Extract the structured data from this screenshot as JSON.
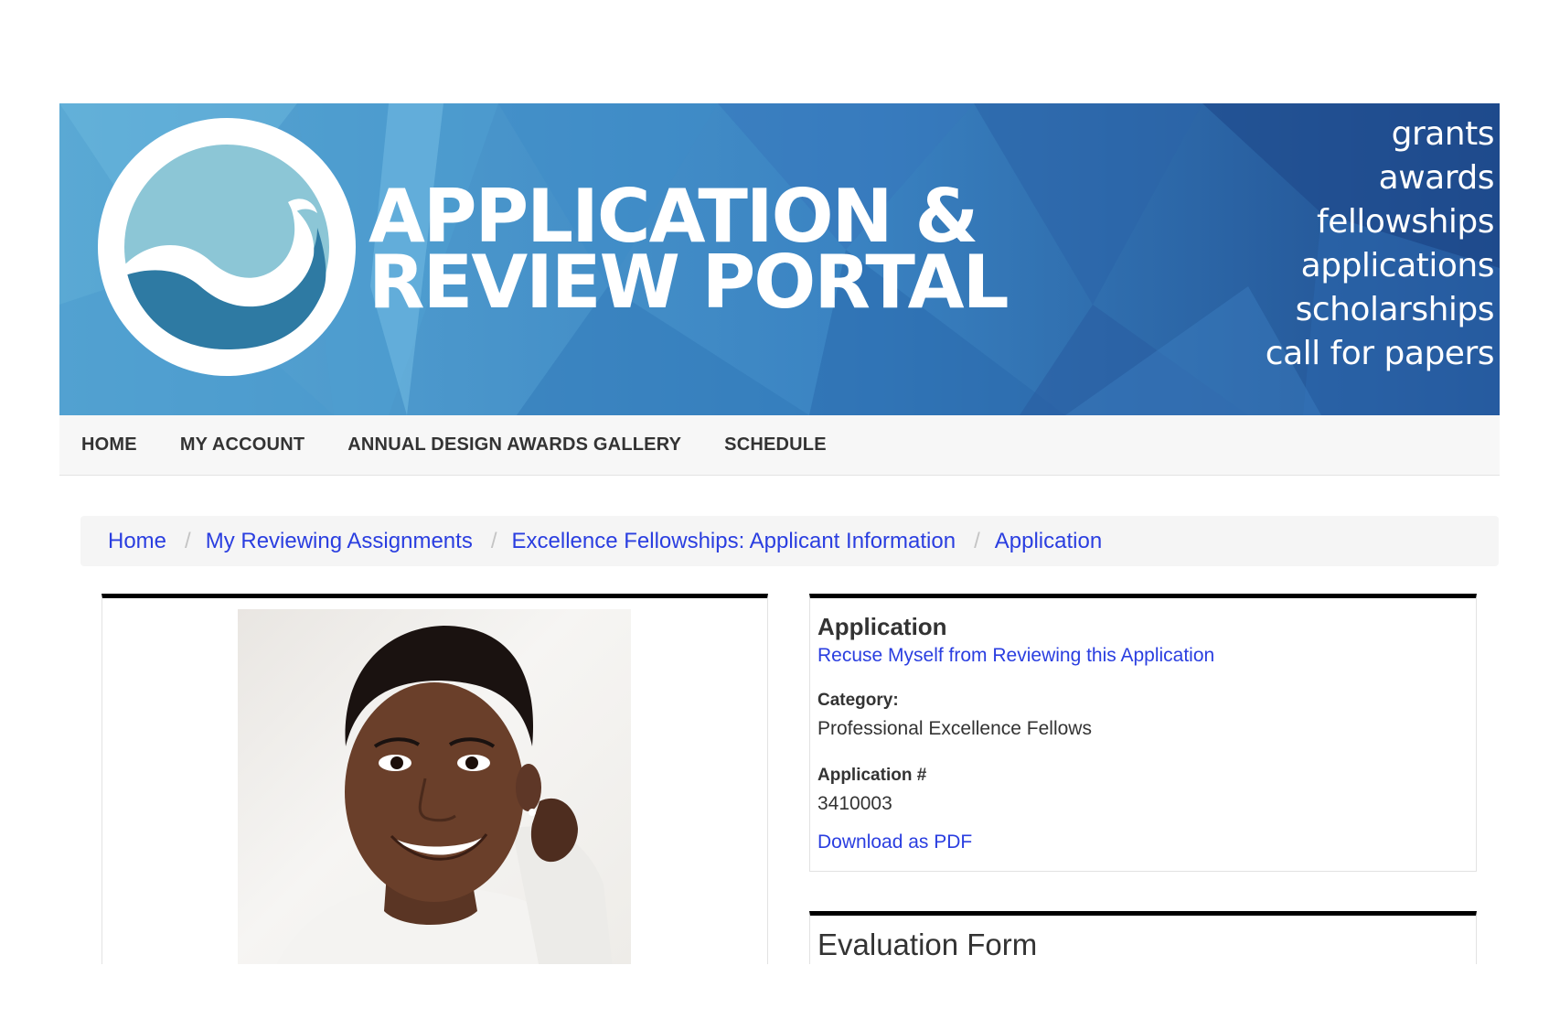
{
  "banner": {
    "title_line1": "APPLICATION &",
    "title_line2": "REVIEW PORTAL",
    "tags": [
      "grants",
      "awards",
      "fellowships",
      "applications",
      "scholarships",
      "call for papers"
    ],
    "colors": {
      "light": "#63b3d8",
      "mid": "#3b86c4",
      "dark": "#1f4f93"
    }
  },
  "nav": {
    "items": [
      "HOME",
      "MY ACCOUNT",
      "ANNUAL DESIGN AWARDS GALLERY",
      "SCHEDULE"
    ]
  },
  "breadcrumb": {
    "items": [
      "Home",
      "My Reviewing Assignments",
      "Excellence Fellowships: Applicant Information",
      "Application"
    ]
  },
  "application": {
    "title": "Application",
    "recuse_link": "Recuse Myself from Reviewing this Application",
    "category_label": "Category:",
    "category_value": "Professional Excellence Fellows",
    "number_label": "Application #",
    "number_value": "3410003",
    "download_link": "Download as PDF"
  },
  "evaluation": {
    "title": "Evaluation Form"
  },
  "photo": {
    "icon": "applicant-portrait"
  }
}
